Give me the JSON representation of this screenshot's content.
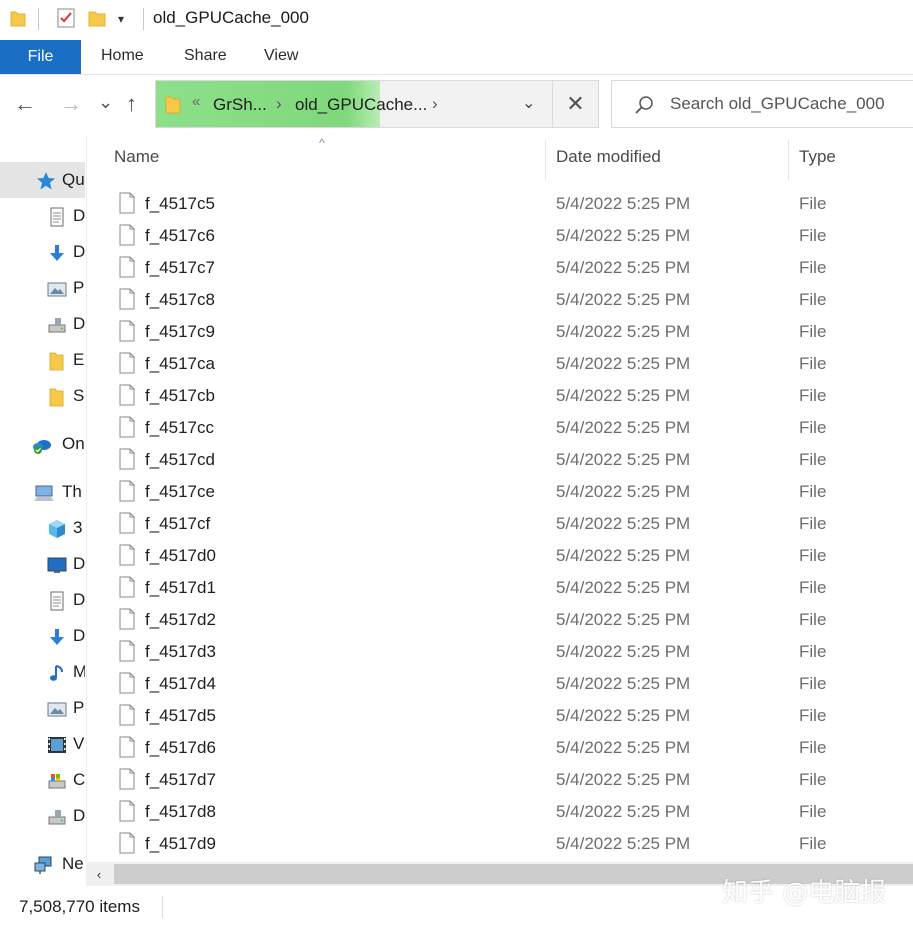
{
  "window": {
    "title": "old_GPUCache_000",
    "quick_access_dropdown": "▾"
  },
  "ribbon": {
    "tabs": [
      "File",
      "Home",
      "Share",
      "View"
    ]
  },
  "nav": {
    "back": "←",
    "forward": "→",
    "recent": "⌄",
    "up": "↑"
  },
  "address": {
    "overflow": "«",
    "crumbs": [
      "GrSh...",
      "old_GPUCache..."
    ],
    "chevron": "›",
    "dropdown": "⌄",
    "clear": "✕",
    "highlight_color": "#8de08a"
  },
  "search": {
    "placeholder": "Search old_GPUCache_000"
  },
  "sidebar": {
    "items": [
      {
        "label": "Qu",
        "icon": "star-icon"
      },
      {
        "label": "D",
        "icon": "document-icon"
      },
      {
        "label": "D",
        "icon": "download-icon"
      },
      {
        "label": "P",
        "icon": "pictures-icon"
      },
      {
        "label": "D",
        "icon": "drive-icon"
      },
      {
        "label": "E",
        "icon": "folder-icon"
      },
      {
        "label": "S",
        "icon": "folder-icon"
      },
      {
        "label": "On",
        "icon": "onedrive-icon"
      },
      {
        "label": "Th",
        "icon": "computer-icon"
      },
      {
        "label": "3",
        "icon": "cube-icon"
      },
      {
        "label": "D",
        "icon": "desktop-icon"
      },
      {
        "label": "D",
        "icon": "document-icon"
      },
      {
        "label": "D",
        "icon": "download-icon"
      },
      {
        "label": "M",
        "icon": "music-icon"
      },
      {
        "label": "P",
        "icon": "pictures-icon"
      },
      {
        "label": "V",
        "icon": "video-icon"
      },
      {
        "label": "C",
        "icon": "system-drive-icon"
      },
      {
        "label": "D",
        "icon": "drive-icon"
      },
      {
        "label": "Ne",
        "icon": "network-icon"
      }
    ]
  },
  "columns": {
    "name": "Name",
    "date": "Date modified",
    "type": "Type",
    "sort_indicator": "^"
  },
  "files": [
    {
      "name": "f_4517c5",
      "date": "5/4/2022 5:25 PM",
      "type": "File"
    },
    {
      "name": "f_4517c6",
      "date": "5/4/2022 5:25 PM",
      "type": "File"
    },
    {
      "name": "f_4517c7",
      "date": "5/4/2022 5:25 PM",
      "type": "File"
    },
    {
      "name": "f_4517c8",
      "date": "5/4/2022 5:25 PM",
      "type": "File"
    },
    {
      "name": "f_4517c9",
      "date": "5/4/2022 5:25 PM",
      "type": "File"
    },
    {
      "name": "f_4517ca",
      "date": "5/4/2022 5:25 PM",
      "type": "File"
    },
    {
      "name": "f_4517cb",
      "date": "5/4/2022 5:25 PM",
      "type": "File"
    },
    {
      "name": "f_4517cc",
      "date": "5/4/2022 5:25 PM",
      "type": "File"
    },
    {
      "name": "f_4517cd",
      "date": "5/4/2022 5:25 PM",
      "type": "File"
    },
    {
      "name": "f_4517ce",
      "date": "5/4/2022 5:25 PM",
      "type": "File"
    },
    {
      "name": "f_4517cf",
      "date": "5/4/2022 5:25 PM",
      "type": "File"
    },
    {
      "name": "f_4517d0",
      "date": "5/4/2022 5:25 PM",
      "type": "File"
    },
    {
      "name": "f_4517d1",
      "date": "5/4/2022 5:25 PM",
      "type": "File"
    },
    {
      "name": "f_4517d2",
      "date": "5/4/2022 5:25 PM",
      "type": "File"
    },
    {
      "name": "f_4517d3",
      "date": "5/4/2022 5:25 PM",
      "type": "File"
    },
    {
      "name": "f_4517d4",
      "date": "5/4/2022 5:25 PM",
      "type": "File"
    },
    {
      "name": "f_4517d5",
      "date": "5/4/2022 5:25 PM",
      "type": "File"
    },
    {
      "name": "f_4517d6",
      "date": "5/4/2022 5:25 PM",
      "type": "File"
    },
    {
      "name": "f_4517d7",
      "date": "5/4/2022 5:25 PM",
      "type": "File"
    },
    {
      "name": "f_4517d8",
      "date": "5/4/2022 5:25 PM",
      "type": "File"
    },
    {
      "name": "f_4517d9",
      "date": "5/4/2022 5:25 PM",
      "type": "File"
    }
  ],
  "scrollbar": {
    "left_arrow": "‹"
  },
  "status": {
    "item_count": "7,508,770 items"
  },
  "watermark": "知乎 @电脑报",
  "colors": {
    "file_tab": "#1a6ec4",
    "selected_sidebar": "#e5e5e5"
  }
}
